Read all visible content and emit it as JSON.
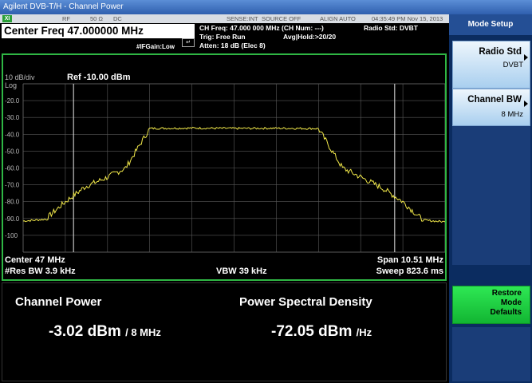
{
  "window": {
    "title": "Agilent DVB-T/H - Channel Power"
  },
  "status_bar": {
    "mode_badge": "XI",
    "rf": "RF",
    "impedance": "50 Ω",
    "coupling": "DC",
    "sense": "SENSE:INT",
    "source": "SOURCE OFF",
    "align": "ALIGN AUTO",
    "timestamp": "04:35:49 PM Nov 15, 2013",
    "center_freq": "Center Freq 47.000000 MHz",
    "if_gain": "#IFGain:Low",
    "ch_freq": "CH Freq: 47.000 000 MHz (CH Num: ---)",
    "trig": "Trig: Free Run",
    "avg_hold": "Avg|Hold:>20/20",
    "atten": "Atten: 18 dB (Elec 8)",
    "radio_std": "Radio Std: DVBT"
  },
  "softkeys": {
    "menu_title": "Mode Setup",
    "radio_std_label": "Radio Std",
    "radio_std_value": "DVBT",
    "channel_bw_label": "Channel BW",
    "channel_bw_value": "8 MHz",
    "restore_line1": "Restore",
    "restore_line2": "Mode",
    "restore_line3": "Defaults"
  },
  "display": {
    "scale": "10 dB/div",
    "ref_level": "Ref -10.00 dBm",
    "log_label": "Log",
    "center": "Center  47 MHz",
    "res_bw": "#Res BW  3.9 kHz",
    "vbw": "VBW  39 kHz",
    "span": "Span 10.51 MHz",
    "sweep": "Sweep  823.6 ms",
    "trace_color": "#f2e94a",
    "grid_color": "#5a5a5a",
    "border_color": "#2fb644"
  },
  "chart_data": {
    "type": "line",
    "title": "",
    "xlabel": "",
    "ylabel": "",
    "yticks": [
      "-20.0",
      "-30.0",
      "-40.0",
      "-50.0",
      "-60.0",
      "-70.0",
      "-80.0",
      "-90.0",
      "-100"
    ],
    "ylim": [
      -110,
      -10
    ],
    "xlim_mhz": [
      41.745,
      52.255
    ],
    "grid": true,
    "series": [
      {
        "x_mhz": [
          41.745,
          42.3,
          42.8,
          43.3,
          43.8,
          44.3,
          44.9,
          46.0,
          47.0,
          48.0,
          49.1,
          49.7,
          50.2,
          50.7,
          51.2,
          51.7,
          52.255
        ],
        "y_dbm": [
          -91.5,
          -90.5,
          -80,
          -71,
          -66,
          -60,
          -36.5,
          -36.3,
          -36.5,
          -36.4,
          -36.6,
          -60,
          -66,
          -72,
          -80,
          -91,
          -92
        ]
      }
    ],
    "markers_mhz": [
      43.0,
      51.0
    ]
  },
  "results": {
    "channel_power_title": "Channel Power",
    "channel_power_value": "-3.02 dBm",
    "channel_power_unit": "/ 8 MHz",
    "psd_title": "Power Spectral Density",
    "psd_value": "-72.05 dBm",
    "psd_unit": "/Hz"
  }
}
